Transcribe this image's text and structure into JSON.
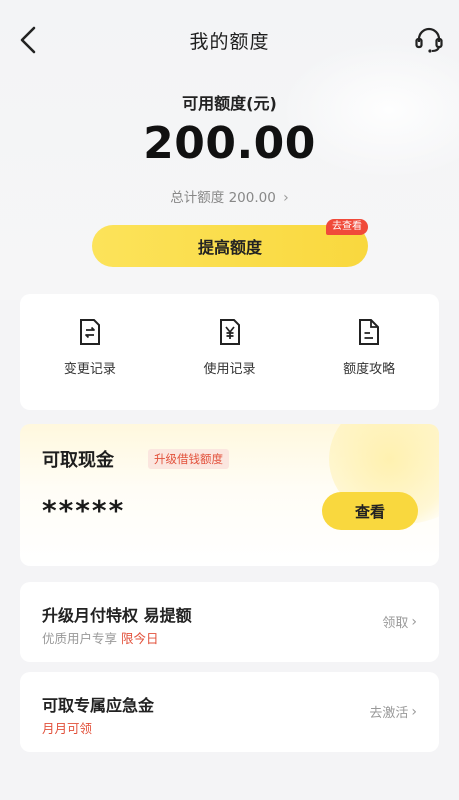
{
  "nav": {
    "title": "我的额度"
  },
  "credit": {
    "label": "可用额度(元)",
    "amount": "200.00",
    "total": "总计额度 200.00",
    "raise_button": "提高额度",
    "raise_badge": "去查看"
  },
  "actions": [
    {
      "label": "变更记录",
      "icon": "exchange-doc-icon"
    },
    {
      "label": "使用记录",
      "icon": "yuan-doc-icon"
    },
    {
      "label": "额度攻略",
      "icon": "guide-doc-icon"
    }
  ],
  "cash": {
    "title": "可取现金",
    "tag": "升级借钱额度",
    "amount": "*****",
    "view_button": "查看"
  },
  "rows": [
    {
      "title": "升级月付特权 易提额",
      "sub": "优质用户专享",
      "sub_highlight": "限今日",
      "action": "领取"
    },
    {
      "title": "可取专属应急金",
      "sub": "月月可领",
      "action": "去激活"
    }
  ],
  "colors": {
    "accent_yellow": "#f9d83e",
    "badge_red": "#f04a3a",
    "highlight_red": "#e2513b"
  }
}
